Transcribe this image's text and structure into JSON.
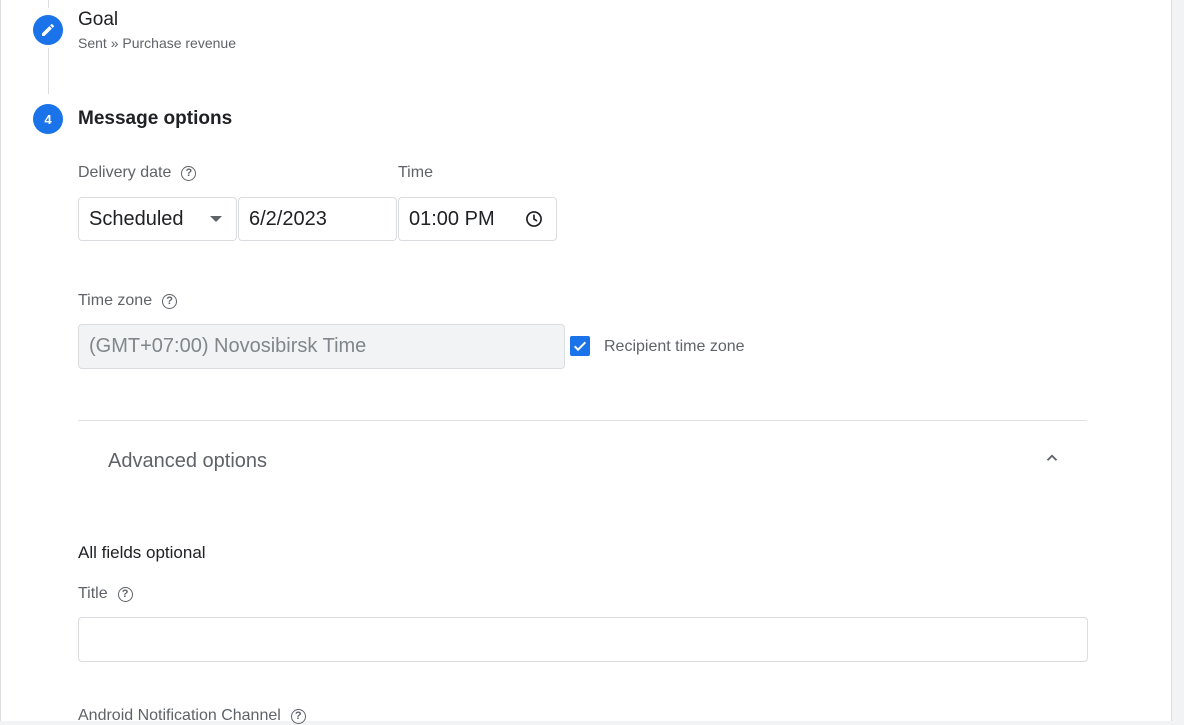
{
  "step3": {
    "title": "Goal",
    "subtitle": "Sent » Purchase revenue",
    "icon": "pencil-icon"
  },
  "step4": {
    "number": "4",
    "title": "Message options"
  },
  "delivery": {
    "label": "Delivery date",
    "type_value": "Scheduled",
    "date_value": "6/2/2023",
    "time_label": "Time",
    "time_value": "01:00 PM"
  },
  "timezone": {
    "label": "Time zone",
    "value": "(GMT+07:00) Novosibirsk Time",
    "recipient_label": "Recipient time zone",
    "recipient_checked": true
  },
  "advanced": {
    "title": "Advanced options",
    "subtitle": "All fields optional",
    "title_field_label": "Title",
    "title_field_value": "",
    "android_channel_label": "Android Notification Channel"
  },
  "colors": {
    "accent": "#1a73e8"
  }
}
